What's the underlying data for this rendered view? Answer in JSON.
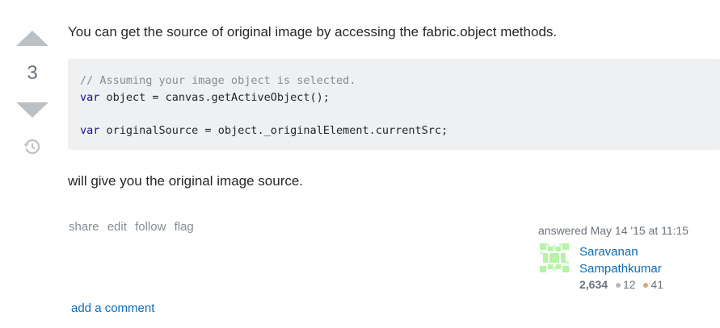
{
  "vote": {
    "count": "3",
    "up_icon": "arrow-up-icon",
    "down_icon": "arrow-down-icon",
    "history_icon": "history-icon"
  },
  "post": {
    "paragraph_1": "You can get the source of original image by accessing the fabric.object methods.",
    "code": {
      "line1_comment": "// Assuming your image object is selected.",
      "line2_keyword": "var",
      "line2_rest": " object = canvas.getActiveObject();",
      "line4_keyword": "var",
      "line4_rest": " originalSource = object._originalElement.currentSrc;"
    },
    "paragraph_2": "will give you the original image source."
  },
  "post_menu": {
    "share": "share",
    "edit": "edit",
    "follow": "follow",
    "flag": "flag"
  },
  "user_card": {
    "action_time": "answered May 14 '15 at 11:15",
    "name_line1": "Saravanan",
    "name_line2": "Sampathkumar",
    "reputation": "2,634",
    "silver_badges": "12",
    "bronze_badges": "41",
    "colors": {
      "silver": "#b4b8bc",
      "bronze": "#d1a684",
      "link": "#0c6cb5"
    }
  },
  "comments": {
    "add_comment": "add a comment"
  }
}
